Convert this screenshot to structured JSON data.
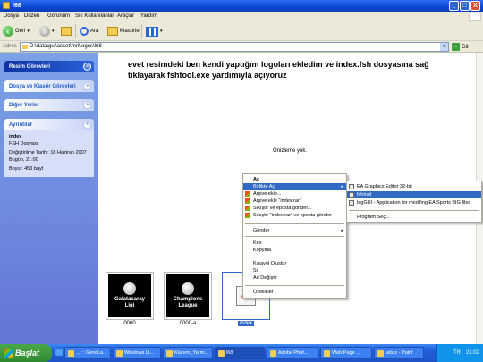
{
  "window": {
    "title": "l68",
    "min_glyph": "_",
    "max_glyph": "□",
    "close_glyph": "X"
  },
  "menubar": {
    "items": [
      "Dosya",
      "Düzen",
      "Görünüm",
      "Sık Kullanılanlar",
      "Araçlar",
      "Yardım"
    ]
  },
  "toolbar": {
    "back_label": "Geri",
    "search_label": "Ara",
    "folders_label": "Klasörler"
  },
  "address": {
    "label": "Adres",
    "value": "D:\\data\\gul\\asset\\mri\\logos\\l68",
    "go_label": "Git"
  },
  "leftpane": {
    "picture_tasks": "Resim Görevleri",
    "file_folder_tasks": "Dosya ve Klasör Görevleri",
    "other_places": "Diğer Yerler",
    "details": "Ayrıntılar",
    "detail_name": "index",
    "detail_type": "FSH Dosyası",
    "detail_modified": "Değiştirilme Tarihi: 18 Haziran 2007 Bugün, 21:00",
    "detail_size": "Boyut: 453 bayt"
  },
  "content": {
    "preview_text": "evet resimdeki ben kendi yaptığım logoları ekledim ve index.fsh dosyasına sağ tıklayarak fshtool.exe yardımıyla açıyoruz",
    "no_preview": "Önizleme yok.",
    "thumbs": [
      {
        "label": "0000",
        "art_line1": "Galatasaray",
        "art_line2": "Ligi"
      },
      {
        "label": "0000-a",
        "art_line1": "Champions",
        "art_line2": "League"
      },
      {
        "label": "index",
        "art_line1": "SAVE",
        "art_line2": ""
      }
    ]
  },
  "context_menu": {
    "items": [
      {
        "label": "Aç",
        "bold": true
      },
      {
        "label": "Birlikte Aç",
        "highlighted": true,
        "submenu": true
      },
      {
        "label": "Arşive ekle...",
        "icon": true
      },
      {
        "label": "Arşive ekle \"index.rar\"",
        "icon": true
      },
      {
        "label": "Sıkıştır ve eposta gönder...",
        "icon": true
      },
      {
        "label": "Sıkıştır \"index.rar\" ve eposta gönder",
        "icon": true
      },
      {
        "label": "Gönder",
        "submenu": true
      },
      {
        "label": "Kes"
      },
      {
        "label": "Kopyala"
      },
      {
        "label": "Kısayol Oluştur"
      },
      {
        "label": "Sil"
      },
      {
        "label": "Ad Değiştir"
      },
      {
        "label": "Özellikler"
      }
    ],
    "arrow_glyph": "▸"
  },
  "open_with": {
    "items": [
      {
        "label": "EA Graphics Editor 32-bit"
      },
      {
        "label": "fshtool",
        "highlighted": true
      },
      {
        "label": "bigGUI - Application for modifing EA Sports BIG files"
      },
      {
        "label": "Program Seç..."
      }
    ]
  },
  "taskbar": {
    "start_label": "Başlat",
    "items": [
      "....:: GencLa...",
      "Windows Li...",
      "Klarem_Yarm...",
      "l68",
      "Adobe Phot...",
      "Web Page ...",
      "adsız - Paint"
    ],
    "tray_lang": "TR",
    "clock": "21:02"
  }
}
